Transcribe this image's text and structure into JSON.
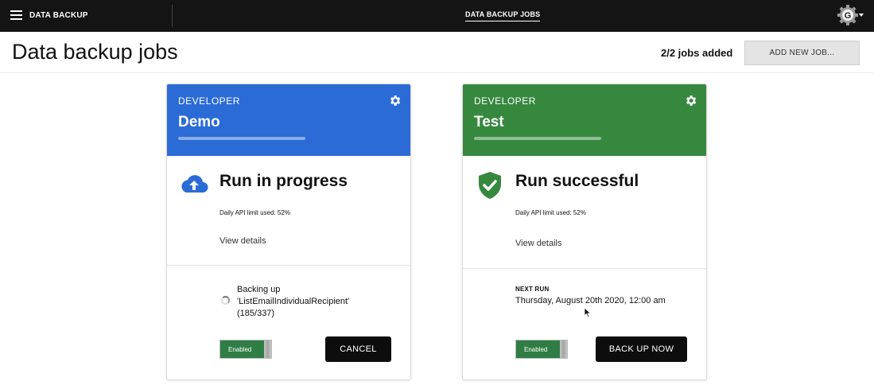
{
  "topbar": {
    "app_title": "DATA BACKUP",
    "nav_link": "DATA BACKUP JOBS",
    "account_initial": "G",
    "menu_icon": "hamburger-menu-icon"
  },
  "header": {
    "title": "Data backup jobs",
    "jobs_count": "2/2 jobs added",
    "add_job_label": "ADD NEW JOB..."
  },
  "cards": [
    {
      "role": "DEVELOPER",
      "name": "Demo",
      "header_color": "#2b6bd6",
      "status_icon": "cloud-upload-icon",
      "status": "Run in progress",
      "api_usage": "Daily API limit used:  52%",
      "view_details": "View details",
      "progress_line1": "Backing up",
      "progress_line2": "'ListEmailIndividualRecipient'",
      "progress_line3": "(185/337)",
      "toggle_label": "Enabled",
      "action_label": "CANCEL"
    },
    {
      "role": "DEVELOPER",
      "name": "Test",
      "header_color": "#36883f",
      "status_icon": "shield-check-icon",
      "status": "Run successful",
      "api_usage": "Daily API limit used:  52%",
      "view_details": "View details",
      "next_run_label": "NEXT RUN",
      "next_run_value": "Thursday, August 20th 2020, 12:00 am",
      "toggle_label": "Enabled",
      "action_label": "BACK UP NOW"
    }
  ],
  "colors": {
    "topbar": "#141414",
    "enabled_toggle": "#2f7d44",
    "action_button": "#0d0d0d"
  }
}
